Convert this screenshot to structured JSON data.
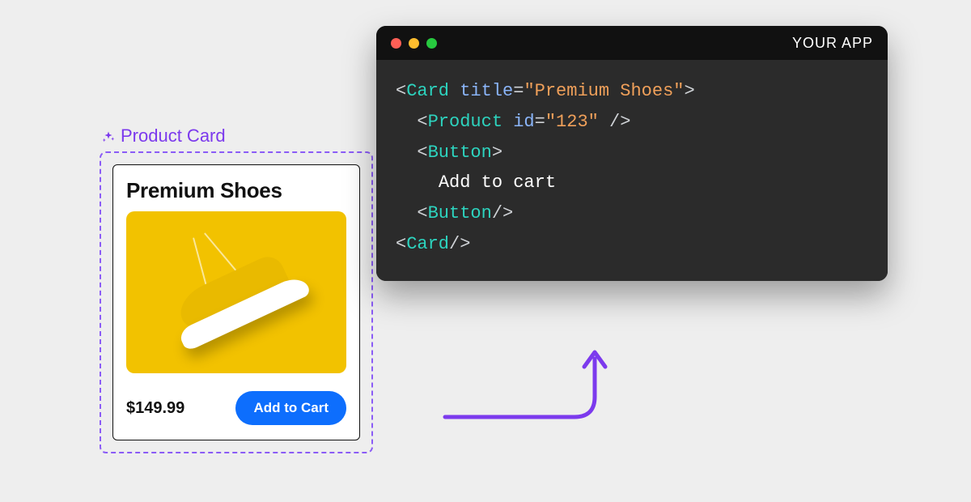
{
  "card": {
    "label": "Product Card",
    "title": "Premium Shoes",
    "price": "$149.99",
    "button_label": "Add to Cart"
  },
  "code_window": {
    "app_title": "YOUR APP",
    "lines": {
      "l1": {
        "open": "<",
        "tag": "Card",
        "sp": " ",
        "attr": "title",
        "eq": "=",
        "val": "\"Premium Shoes\"",
        "close": ">"
      },
      "l2": {
        "indent": "  ",
        "open": "<",
        "tag": "Product",
        "sp": " ",
        "attr": "id",
        "eq": "=",
        "val": "\"123\"",
        "close": " />"
      },
      "l3": {
        "indent": "  ",
        "open": "<",
        "tag": "Button",
        "close": ">"
      },
      "l4": {
        "indent": "    ",
        "text": "Add to cart"
      },
      "l5": {
        "indent": "  ",
        "open": "<",
        "tag": "Button",
        "close": "/>"
      },
      "l6": {
        "open": "<",
        "tag": "Card",
        "close": "/>"
      }
    }
  },
  "colors": {
    "accent_purple": "#7c3aed",
    "button_blue": "#0d6efd",
    "image_bg": "#f2c200"
  }
}
